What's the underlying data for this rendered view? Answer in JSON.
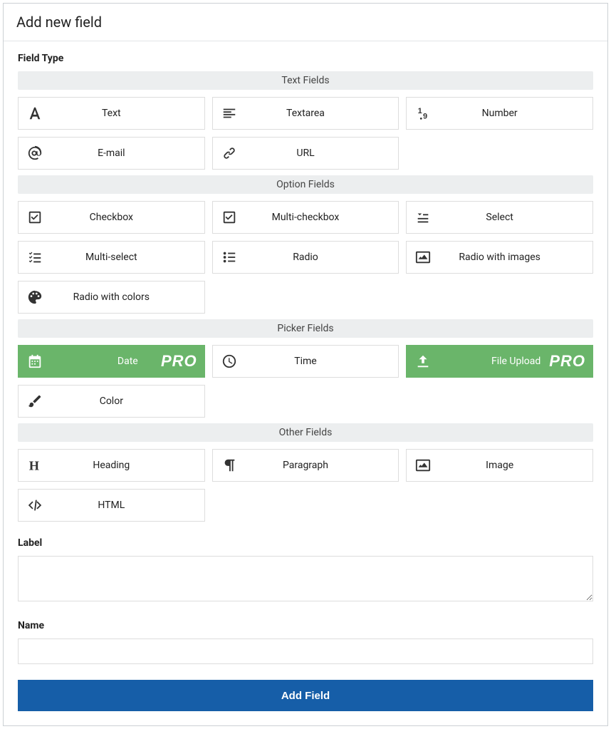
{
  "header": {
    "title": "Add new field"
  },
  "sections": {
    "field_type_label": "Field Type",
    "label_label": "Label",
    "name_label": "Name"
  },
  "groups": {
    "text": {
      "header": "Text Fields",
      "items": [
        {
          "key": "text",
          "label": "Text"
        },
        {
          "key": "textarea",
          "label": "Textarea"
        },
        {
          "key": "number",
          "label": "Number"
        },
        {
          "key": "email",
          "label": "E-mail"
        },
        {
          "key": "url",
          "label": "URL"
        }
      ]
    },
    "option": {
      "header": "Option Fields",
      "items": [
        {
          "key": "checkbox",
          "label": "Checkbox"
        },
        {
          "key": "multi-checkbox",
          "label": "Multi-checkbox"
        },
        {
          "key": "select",
          "label": "Select"
        },
        {
          "key": "multi-select",
          "label": "Multi-select"
        },
        {
          "key": "radio",
          "label": "Radio"
        },
        {
          "key": "radio-images",
          "label": "Radio with images"
        },
        {
          "key": "radio-colors",
          "label": "Radio with colors"
        }
      ]
    },
    "picker": {
      "header": "Picker Fields",
      "items": [
        {
          "key": "date",
          "label": "Date",
          "pro": true
        },
        {
          "key": "time",
          "label": "Time"
        },
        {
          "key": "file",
          "label": "File Upload",
          "pro": true
        },
        {
          "key": "color",
          "label": "Color"
        }
      ]
    },
    "other": {
      "header": "Other Fields",
      "items": [
        {
          "key": "heading",
          "label": "Heading"
        },
        {
          "key": "paragraph",
          "label": "Paragraph"
        },
        {
          "key": "image",
          "label": "Image"
        },
        {
          "key": "html",
          "label": "HTML"
        }
      ]
    }
  },
  "pro_badge": "PRO",
  "form": {
    "label_value": "",
    "name_value": ""
  },
  "submit": {
    "label": "Add Field"
  }
}
